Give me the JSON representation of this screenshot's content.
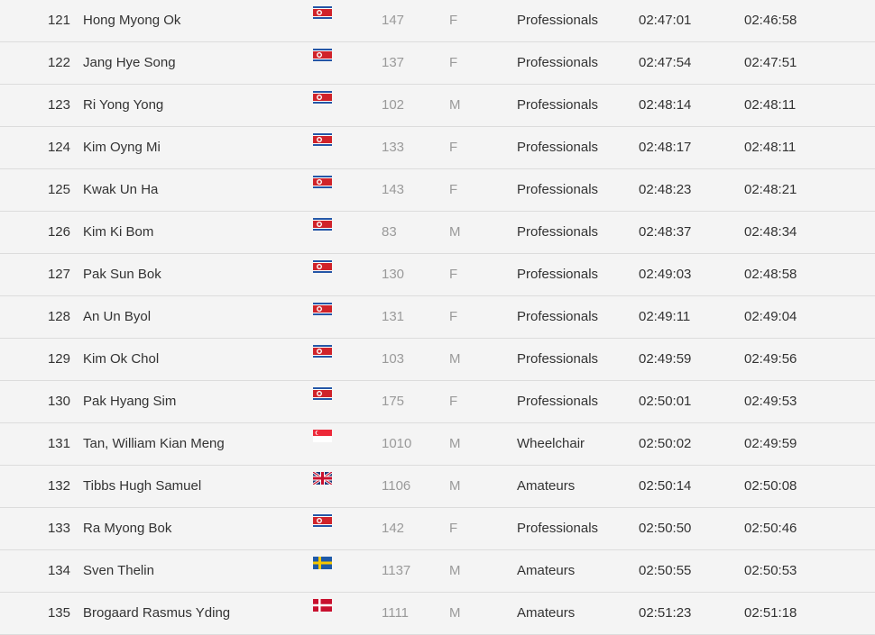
{
  "rows": [
    {
      "rank": "121",
      "name": "Hong Myong Ok",
      "flag": "north-korea-flag-icon",
      "bib": "147",
      "sex": "F",
      "category": "Professionals",
      "gun_time": "02:47:01",
      "net_time": "02:46:58"
    },
    {
      "rank": "122",
      "name": "Jang Hye Song",
      "flag": "north-korea-flag-icon",
      "bib": "137",
      "sex": "F",
      "category": "Professionals",
      "gun_time": "02:47:54",
      "net_time": "02:47:51"
    },
    {
      "rank": "123",
      "name": "Ri Yong Yong",
      "flag": "north-korea-flag-icon",
      "bib": "102",
      "sex": "M",
      "category": "Professionals",
      "gun_time": "02:48:14",
      "net_time": "02:48:11"
    },
    {
      "rank": "124",
      "name": "Kim Oyng Mi",
      "flag": "north-korea-flag-icon",
      "bib": "133",
      "sex": "F",
      "category": "Professionals",
      "gun_time": "02:48:17",
      "net_time": "02:48:11"
    },
    {
      "rank": "125",
      "name": "Kwak Un Ha",
      "flag": "north-korea-flag-icon",
      "bib": "143",
      "sex": "F",
      "category": "Professionals",
      "gun_time": "02:48:23",
      "net_time": "02:48:21"
    },
    {
      "rank": "126",
      "name": "Kim Ki Bom",
      "flag": "north-korea-flag-icon",
      "bib": "83",
      "sex": "M",
      "category": "Professionals",
      "gun_time": "02:48:37",
      "net_time": "02:48:34"
    },
    {
      "rank": "127",
      "name": "Pak Sun Bok",
      "flag": "north-korea-flag-icon",
      "bib": "130",
      "sex": "F",
      "category": "Professionals",
      "gun_time": "02:49:03",
      "net_time": "02:48:58"
    },
    {
      "rank": "128",
      "name": "An Un Byol",
      "flag": "north-korea-flag-icon",
      "bib": "131",
      "sex": "F",
      "category": "Professionals",
      "gun_time": "02:49:11",
      "net_time": "02:49:04"
    },
    {
      "rank": "129",
      "name": "Kim Ok Chol",
      "flag": "north-korea-flag-icon",
      "bib": "103",
      "sex": "M",
      "category": "Professionals",
      "gun_time": "02:49:59",
      "net_time": "02:49:56"
    },
    {
      "rank": "130",
      "name": "Pak Hyang Sim",
      "flag": "north-korea-flag-icon",
      "bib": "175",
      "sex": "F",
      "category": "Professionals",
      "gun_time": "02:50:01",
      "net_time": "02:49:53"
    },
    {
      "rank": "131",
      "name": "Tan, William Kian Meng",
      "flag": "singapore-flag-icon",
      "bib": "1010",
      "sex": "M",
      "category": "Wheelchair",
      "gun_time": "02:50:02",
      "net_time": "02:49:59"
    },
    {
      "rank": "132",
      "name": "Tibbs Hugh Samuel",
      "flag": "uk-flag-icon",
      "bib": "1106",
      "sex": "M",
      "category": "Amateurs",
      "gun_time": "02:50:14",
      "net_time": "02:50:08"
    },
    {
      "rank": "133",
      "name": "Ra Myong Bok",
      "flag": "north-korea-flag-icon",
      "bib": "142",
      "sex": "F",
      "category": "Professionals",
      "gun_time": "02:50:50",
      "net_time": "02:50:46"
    },
    {
      "rank": "134",
      "name": "Sven Thelin",
      "flag": "sweden-flag-icon",
      "bib": "1137",
      "sex": "M",
      "category": "Amateurs",
      "gun_time": "02:50:55",
      "net_time": "02:50:53"
    },
    {
      "rank": "135",
      "name": "Brogaard Rasmus Yding",
      "flag": "denmark-flag-icon",
      "bib": "1111",
      "sex": "M",
      "category": "Amateurs",
      "gun_time": "02:51:23",
      "net_time": "02:51:18"
    }
  ]
}
